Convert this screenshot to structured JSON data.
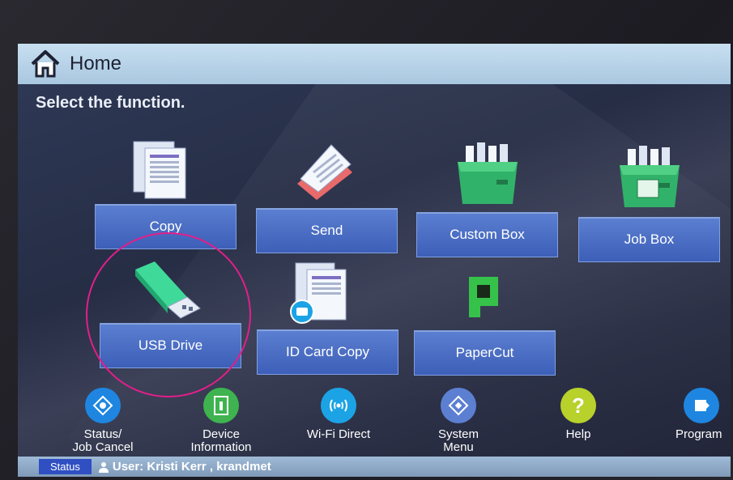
{
  "header": {
    "title": "Home",
    "icon": "home-icon"
  },
  "subtitle": "Select the function.",
  "tiles": [
    {
      "label": "Copy",
      "icon": "copy-icon"
    },
    {
      "label": "Send",
      "icon": "send-icon"
    },
    {
      "label": "Custom Box",
      "icon": "custom-box-icon"
    },
    {
      "label": "Job Box",
      "icon": "job-box-icon"
    },
    {
      "label": "USB Drive",
      "icon": "usb-drive-icon"
    },
    {
      "label": "ID Card Copy",
      "icon": "id-card-copy-icon"
    },
    {
      "label": "PaperCut",
      "icon": "papercut-icon"
    }
  ],
  "bottom_nav": [
    {
      "label_line1": "Status/",
      "label_line2": "Job Cancel",
      "icon": "status-icon",
      "color": "#1e86e0"
    },
    {
      "label_line1": "Device",
      "label_line2": "Information",
      "icon": "device-info-icon",
      "color": "#3fb34f"
    },
    {
      "label_line1": "Wi-Fi Direct",
      "label_line2": "",
      "icon": "wifi-direct-icon",
      "color": "#1ba3e6"
    },
    {
      "label_line1": "System",
      "label_line2": "Menu",
      "icon": "system-menu-icon",
      "color": "#5c7fd1"
    },
    {
      "label_line1": "Help",
      "label_line2": "",
      "icon": "help-icon",
      "color": "#b8d12b"
    },
    {
      "label_line1": "Program",
      "label_line2": "",
      "icon": "program-icon",
      "color": "#1e86e0"
    }
  ],
  "status_bar": {
    "status_label": "Status",
    "user_text": "User: Kristi Kerr , krandmet"
  },
  "colors": {
    "annotation_circle": "#e31e8a",
    "tile_button": "#4a6cc4",
    "header": "#b8d3ea"
  }
}
